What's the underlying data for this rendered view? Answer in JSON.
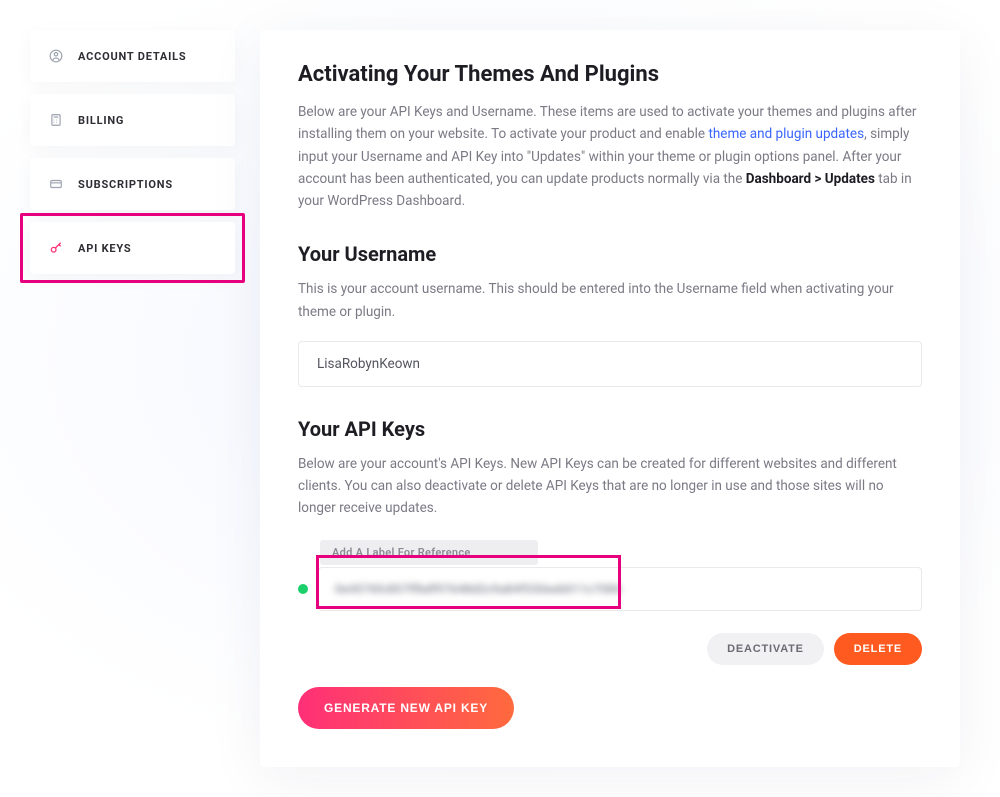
{
  "sidebar": {
    "items": [
      {
        "label": "ACCOUNT DETAILS"
      },
      {
        "label": "BILLING"
      },
      {
        "label": "SUBSCRIPTIONS"
      },
      {
        "label": "API KEYS"
      }
    ]
  },
  "main": {
    "heading": "Activating Your Themes And Plugins",
    "intro_before_link": "Below are your API Keys and Username. These items are used to activate your themes and plugins after installing them on your website. To activate your product and enable ",
    "intro_link": "theme and plugin updates",
    "intro_after_link": ", simply input your Username and API Key into \"Updates\" within your theme or plugin options panel. After your account has been authenticated, you can update products normally via the ",
    "intro_strong": "Dashboard > Updates",
    "intro_tail": " tab in your WordPress Dashboard.",
    "username_heading": "Your Username",
    "username_desc": "This is your account username. This should be entered into the Username field when activating your theme or plugin.",
    "username_value": "LisaRobynKeown",
    "apikeys_heading": "Your API Keys",
    "apikeys_desc": "Below are your account's API Keys. New API Keys can be created for different websites and different clients. You can also deactivate or delete API Keys that are no longer in use and those sites will no longer receive updates.",
    "label_placeholder": "Add A Label For Reference",
    "api_key_masked": "0e4576fc857ffbdf97648d2c9a84f530eeb011c7086",
    "status": "active",
    "buttons": {
      "deactivate": "DEACTIVATE",
      "delete": "DELETE",
      "generate": "GENERATE NEW API KEY"
    }
  },
  "colors": {
    "accent_pink": "#e6007e",
    "link_blue": "#3a66ff",
    "status_green": "#1bcf6b",
    "delete_orange": "#ff5a1f"
  }
}
